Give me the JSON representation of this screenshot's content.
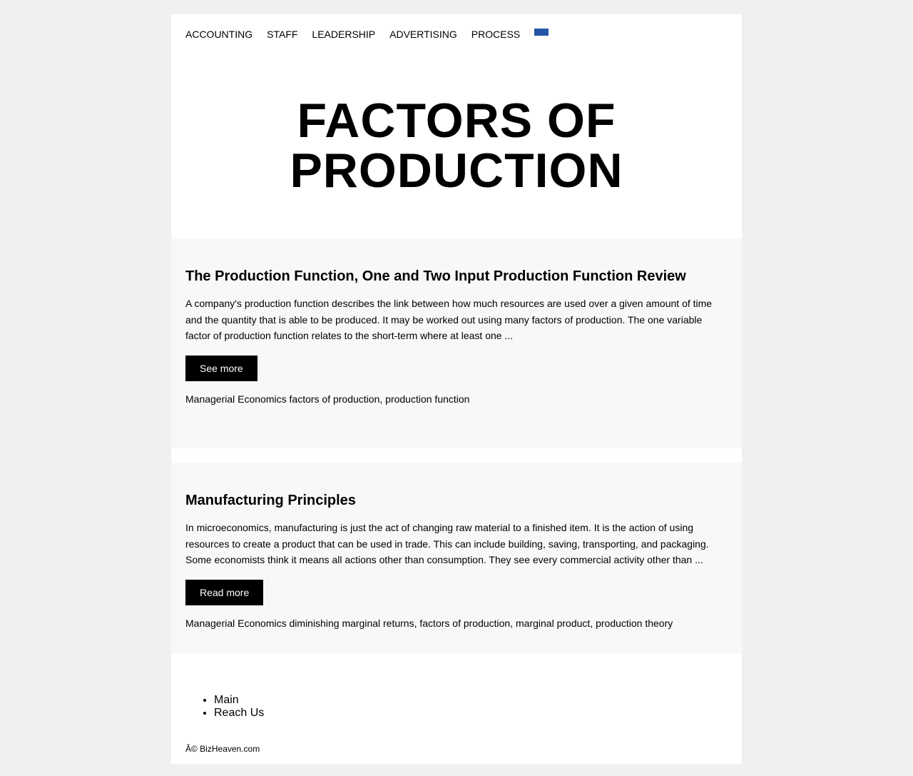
{
  "nav": {
    "items": [
      {
        "label": "ACCOUNTING"
      },
      {
        "label": "STAFF"
      },
      {
        "label": "LEADERSHIP"
      },
      {
        "label": "ADVERTISING"
      },
      {
        "label": "PROCESS"
      }
    ],
    "flag_icon": "language-flag-icon",
    "flag_color": "#2255a6"
  },
  "hero": {
    "title_line1": "FACTORS OF",
    "title_line2": "PRODUCTION"
  },
  "posts": [
    {
      "title": "The Production Function, One and Two Input Production Function Review",
      "excerpt": "A company's production function describes the link between how much resources are used over a given amount of time and the quantity that is able to be produced. It may be worked out using many factors of production. The one variable factor of production function relates to the short-term where at least one ...",
      "button_label": "See more",
      "category": "Managerial Economics",
      "tags": [
        "factors of production",
        "production function"
      ]
    },
    {
      "title": "Manufacturing Principles",
      "excerpt": "In microeconomics, manufacturing is just the act of changing raw material to a finished item. It is the action of using resources to create a product that can be used in trade. This can include building, saving, transporting, and packaging. Some economists think it means all actions other than consumption. They see every commercial activity other than ...",
      "button_label": "Read more",
      "category": "Managerial Economics",
      "tags": [
        "diminishing marginal returns",
        "factors of production",
        "marginal product",
        "production theory"
      ]
    }
  ],
  "footer": {
    "links": [
      {
        "label": "Main"
      },
      {
        "label": "Reach Us"
      }
    ],
    "copyright": "Â© BizHeaven.com"
  },
  "colors": {
    "page_background": "#f0f0f0",
    "content_background": "#ffffff",
    "post_background": "#f8f8f8",
    "button_background": "#000000",
    "button_text": "#ffffff"
  }
}
